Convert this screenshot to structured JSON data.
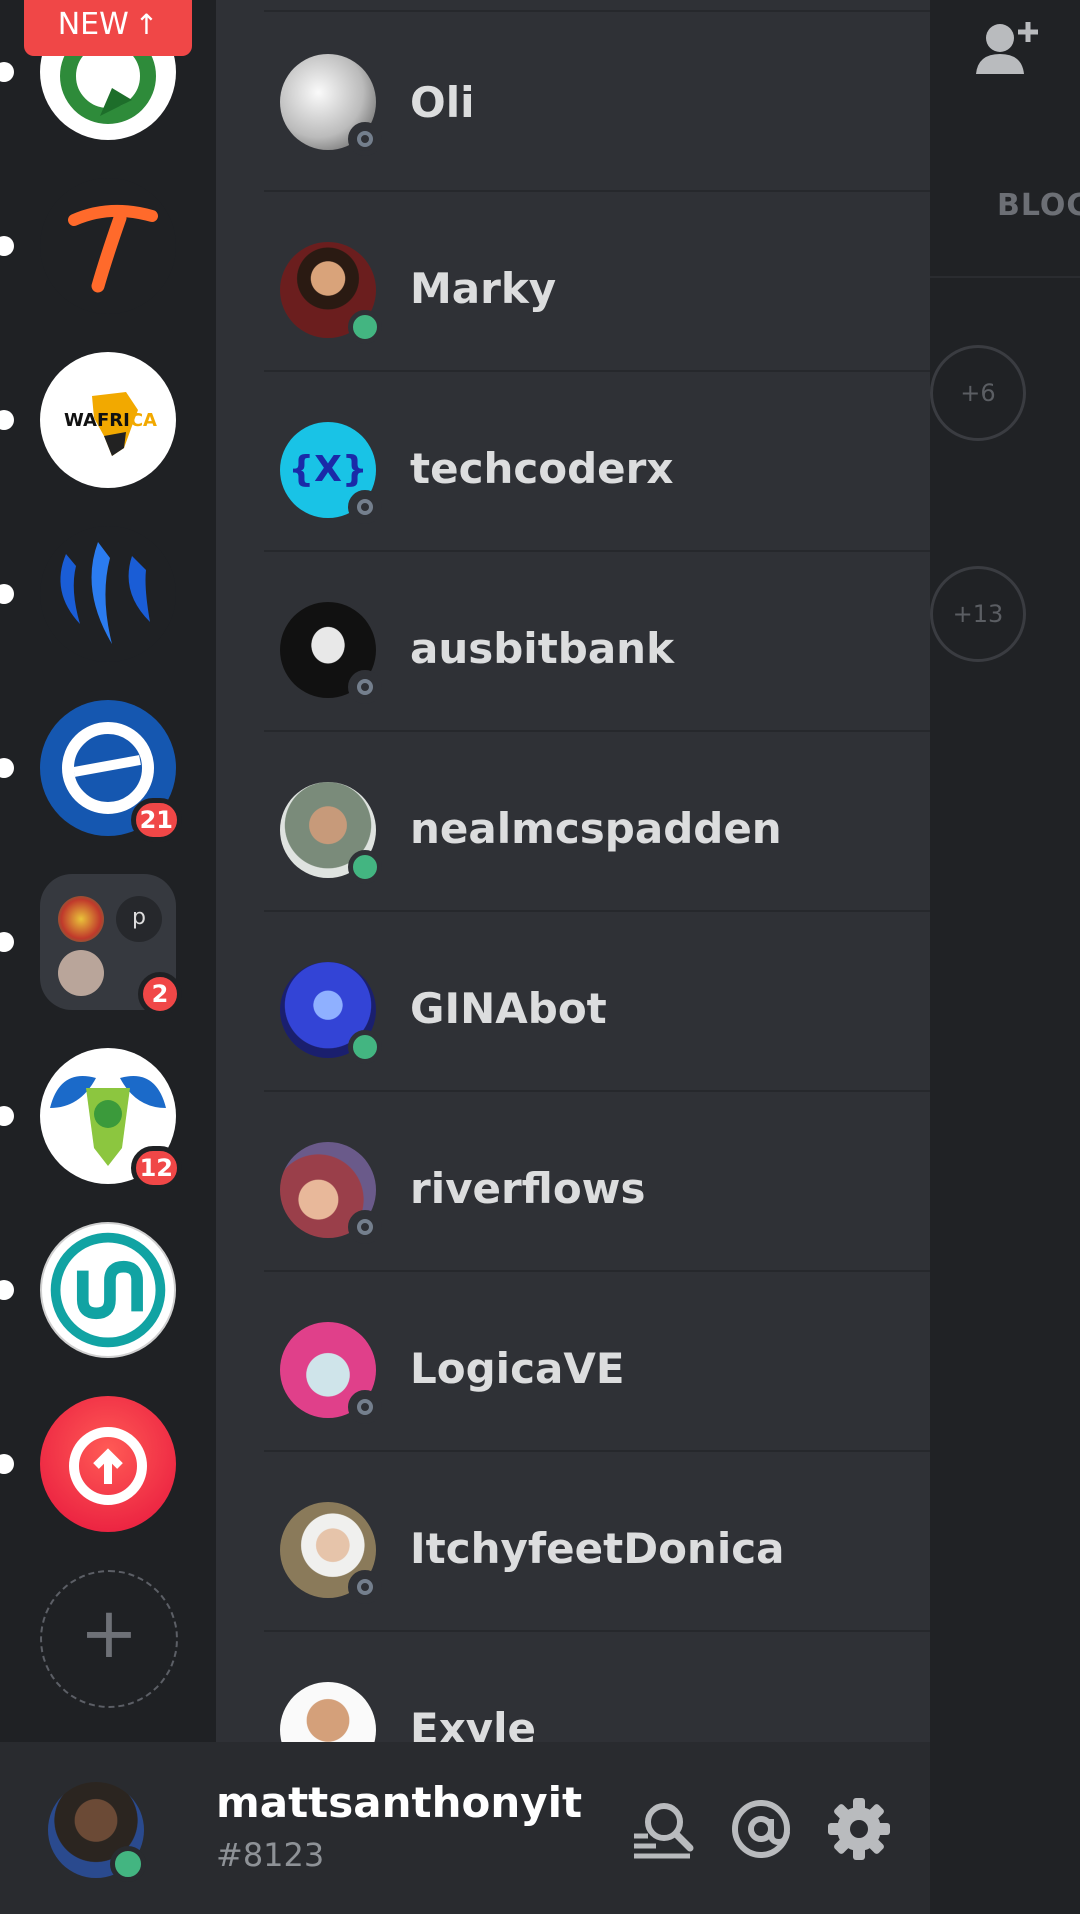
{
  "new_pill": {
    "label": "NEW"
  },
  "guilds": [
    {
      "name": "steem-arrow-server",
      "badge": ""
    },
    {
      "name": "tribe-t-server",
      "badge": ""
    },
    {
      "name": "wafrica-server",
      "badge": "",
      "logo_text": "WAFRI",
      "logo_text2": "CA"
    },
    {
      "name": "steem-logo-server",
      "badge": ""
    },
    {
      "name": "blue-e-server",
      "badge": "21"
    },
    {
      "name": "server-folder",
      "badge": "2",
      "mini_letter": "p"
    },
    {
      "name": "steem-badge-server",
      "badge": "12"
    },
    {
      "name": "ua-server",
      "badge": ""
    },
    {
      "name": "camera-upload-server",
      "badge": ""
    }
  ],
  "dms": [
    {
      "name": "Oli",
      "status": "offline"
    },
    {
      "name": "Marky",
      "status": "online"
    },
    {
      "name": "techcoderx",
      "status": "offline",
      "avatar_text": "{X}"
    },
    {
      "name": "ausbitbank",
      "status": "offline"
    },
    {
      "name": "nealmcspadden",
      "status": "online"
    },
    {
      "name": "GINAbot",
      "status": "online"
    },
    {
      "name": "riverflows",
      "status": "offline"
    },
    {
      "name": "LogicaVE",
      "status": "offline"
    },
    {
      "name": "ItchyfeetDonica",
      "status": "offline"
    },
    {
      "name": "Exyle",
      "status": "none"
    }
  ],
  "right_panel": {
    "tab_label": "BLOC",
    "badges": [
      "+6",
      "+13"
    ]
  },
  "user": {
    "name": "mattsanthonyit",
    "tag": "#8123",
    "status": "online"
  },
  "colors": {
    "online": "#43b581",
    "badge": "#f04747",
    "sidebar": "#1f2124",
    "list": "#2f3136"
  }
}
